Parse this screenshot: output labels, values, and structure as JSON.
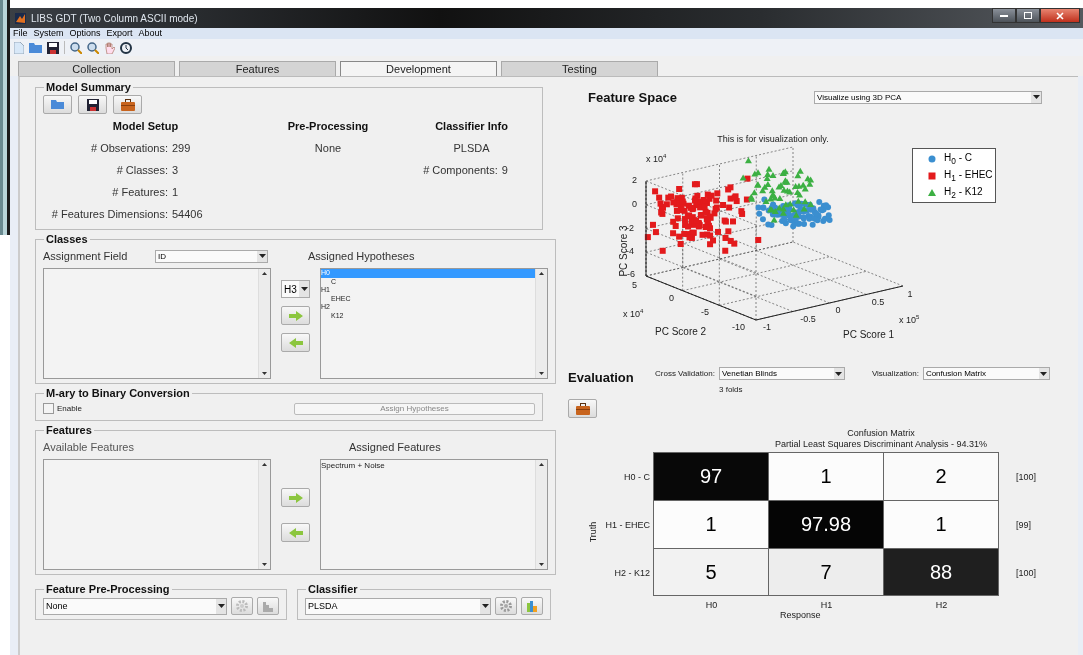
{
  "window": {
    "title": "LIBS GDT (Two Column ASCII mode)"
  },
  "menu": [
    "File",
    "System",
    "Options",
    "Export",
    "About"
  ],
  "tabs": [
    {
      "label": "Collection",
      "selected": false
    },
    {
      "label": "Features",
      "selected": false
    },
    {
      "label": "Development",
      "selected": true
    },
    {
      "label": "Testing",
      "selected": false
    }
  ],
  "model_summary": {
    "title": "Model Summary",
    "columns": [
      {
        "heading": "Model Setup",
        "rows": [
          {
            "label": "# Observations:",
            "value": "299"
          },
          {
            "label": "# Classes:",
            "value": "3"
          },
          {
            "label": "# Features:",
            "value": "1"
          },
          {
            "label": "# Features Dimensions:",
            "value": "54406"
          }
        ]
      },
      {
        "heading": "Pre-Processing",
        "rows": [
          {
            "value": "None"
          }
        ]
      },
      {
        "heading": "Classifier Info",
        "rows": [
          {
            "value": "PLSDA"
          },
          {
            "label": "# Components:",
            "value": "9"
          }
        ]
      }
    ]
  },
  "classes": {
    "title": "Classes",
    "assignment_label": "Assignment Field",
    "assignment_value": "ID",
    "assigned_label": "Assigned Hypotheses",
    "hypothesis_select": "H3",
    "hypotheses": [
      {
        "label": "H0",
        "selected": true,
        "children": [
          {
            "label": "C",
            "selected": false
          }
        ]
      },
      {
        "label": "H1",
        "selected": false,
        "children": [
          {
            "label": "EHEC",
            "selected": false
          }
        ]
      },
      {
        "label": "H2",
        "selected": false,
        "children": [
          {
            "label": "K12",
            "selected": false
          }
        ]
      }
    ]
  },
  "mary": {
    "title": "M-ary to Binary Conversion",
    "enable": {
      "label": "Enable",
      "checked": false
    },
    "assign_button": {
      "label": "Assign Hypotheses",
      "disabled": true
    }
  },
  "features": {
    "title": "Features",
    "available_label": "Available Features",
    "assigned_label": "Assigned Features",
    "assigned": [
      "Spectrum + Noise"
    ]
  },
  "feature_preprocessing": {
    "title": "Feature Pre-Processing",
    "value": "None"
  },
  "classifier": {
    "title": "Classifier",
    "value": "PLSDA"
  },
  "feature_space": {
    "title": "Feature Space",
    "visualize": "Visualize using 3D PCA",
    "plot": {
      "title": "This is for visualization only.",
      "xlabel": "PC Score 1",
      "ylabel": "PC Score 2",
      "zlabel": "PC Score 3",
      "x_ticks": [
        "-1",
        "-0.5",
        "0",
        "0.5",
        "1"
      ],
      "y_ticks": [
        "5",
        "0",
        "-5",
        "-10"
      ],
      "z_ticks": [
        "2",
        "0",
        "-2",
        "-4",
        "-6"
      ],
      "x_multiplier": {
        "base": "x 10",
        "power": "5"
      },
      "y_multiplier": {
        "base": "x 10",
        "power": "4"
      },
      "z_multiplier": {
        "base": "x 10",
        "power": "4"
      },
      "legend": [
        {
          "label": "H$_{0}$ - C",
          "color": "#3b8fd0",
          "kind": "circle"
        },
        {
          "label": "H$_{1}$ - EHEC",
          "color": "#e31a1c",
          "kind": "square"
        },
        {
          "label": "H$_{2}$ - K12",
          "color": "#3cb043",
          "kind": "triangle"
        }
      ]
    }
  },
  "evaluation": {
    "title": "Evaluation",
    "cross_validation_label": "Cross Validation:",
    "cross_validation": "Venetian Blinds",
    "folds": "3 folds",
    "visualization_label": "Visualization:",
    "visualization": "Confusion Matrix",
    "matrix": {
      "title": "Confusion Matrix",
      "subtitle": "Partial Least Squares Discriminant Analysis - 94.31%",
      "ylabel": "Truth",
      "xlabel": "Response",
      "response_labels": [
        "H0",
        "H1",
        "H2"
      ],
      "truth_rows": [
        {
          "label": "H0 - C",
          "cells": [
            "97",
            "1",
            "2"
          ],
          "total": "[100]"
        },
        {
          "label": "H1 - EHEC",
          "cells": [
            "1",
            "97.98",
            "1"
          ],
          "total": "[99]"
        },
        {
          "label": "H2 - K12",
          "cells": [
            "5",
            "7",
            "88"
          ],
          "total": "[100]"
        }
      ]
    }
  }
}
